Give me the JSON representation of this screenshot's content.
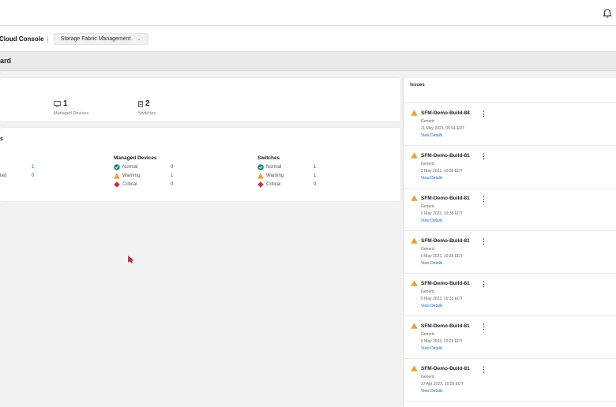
{
  "header": {
    "app_title": "Cloud Console",
    "separator": "|",
    "context_selector": "Storage Fabric Management",
    "chevron": "⌄",
    "notification_icon": "bell-icon"
  },
  "page": {
    "title": "ard"
  },
  "summary": {
    "managed_devices": {
      "count": "1",
      "label": "Managed Devices",
      "icon": "device-icon"
    },
    "switches": {
      "count": "2",
      "label": "Switches",
      "icon": "switch-icon"
    }
  },
  "status_card": {
    "title": "s",
    "partial_column": {
      "rows": [
        {
          "label": "",
          "value": "1"
        },
        {
          "label": "ted",
          "value": "0"
        }
      ]
    },
    "managed_devices": {
      "title": "Managed Devices",
      "rows": [
        {
          "label": "Normal",
          "value": "0"
        },
        {
          "label": "Warning",
          "value": "1"
        },
        {
          "label": "Critical",
          "value": "0"
        }
      ]
    },
    "switches": {
      "title": "Switches",
      "rows": [
        {
          "label": "Normal",
          "value": "1"
        },
        {
          "label": "Warning",
          "value": "1"
        },
        {
          "label": "Critical",
          "value": "0"
        }
      ]
    }
  },
  "issues": {
    "title": "Issues",
    "items": [
      {
        "name": "SFM-Demo-Build-88",
        "type": "Generic",
        "time": "11 May 2023, 05:04 EDT",
        "link": "View Details"
      },
      {
        "name": "SFM-Demo-Build-81",
        "type": "Generic",
        "time": "5 May 2023, 10:36 EDT",
        "link": "View Details"
      },
      {
        "name": "SFM-Demo-Build-81",
        "type": "Generic",
        "time": "5 May 2023, 10:36 EDT",
        "link": "View Details"
      },
      {
        "name": "SFM-Demo-Build-81",
        "type": "Generic",
        "time": "5 May 2023, 10:36 EDT",
        "link": "View Details"
      },
      {
        "name": "SFM-Demo-Build-81",
        "type": "Generic",
        "time": "5 May 2023, 10:31 EDT",
        "link": "View Details"
      },
      {
        "name": "SFM-Demo-Build-81",
        "type": "Generic",
        "time": "5 May 2023, 10:26 EDT",
        "link": "View Details"
      },
      {
        "name": "SFM-Demo-Build-81",
        "type": "Generic",
        "time": "27 Apr 2023, 16:59 EDT",
        "link": "View Details"
      }
    ]
  },
  "colors": {
    "normal": "#1e8c7e",
    "warning": "#f0a030",
    "critical": "#c62f4e",
    "link": "#1a6bb5"
  }
}
